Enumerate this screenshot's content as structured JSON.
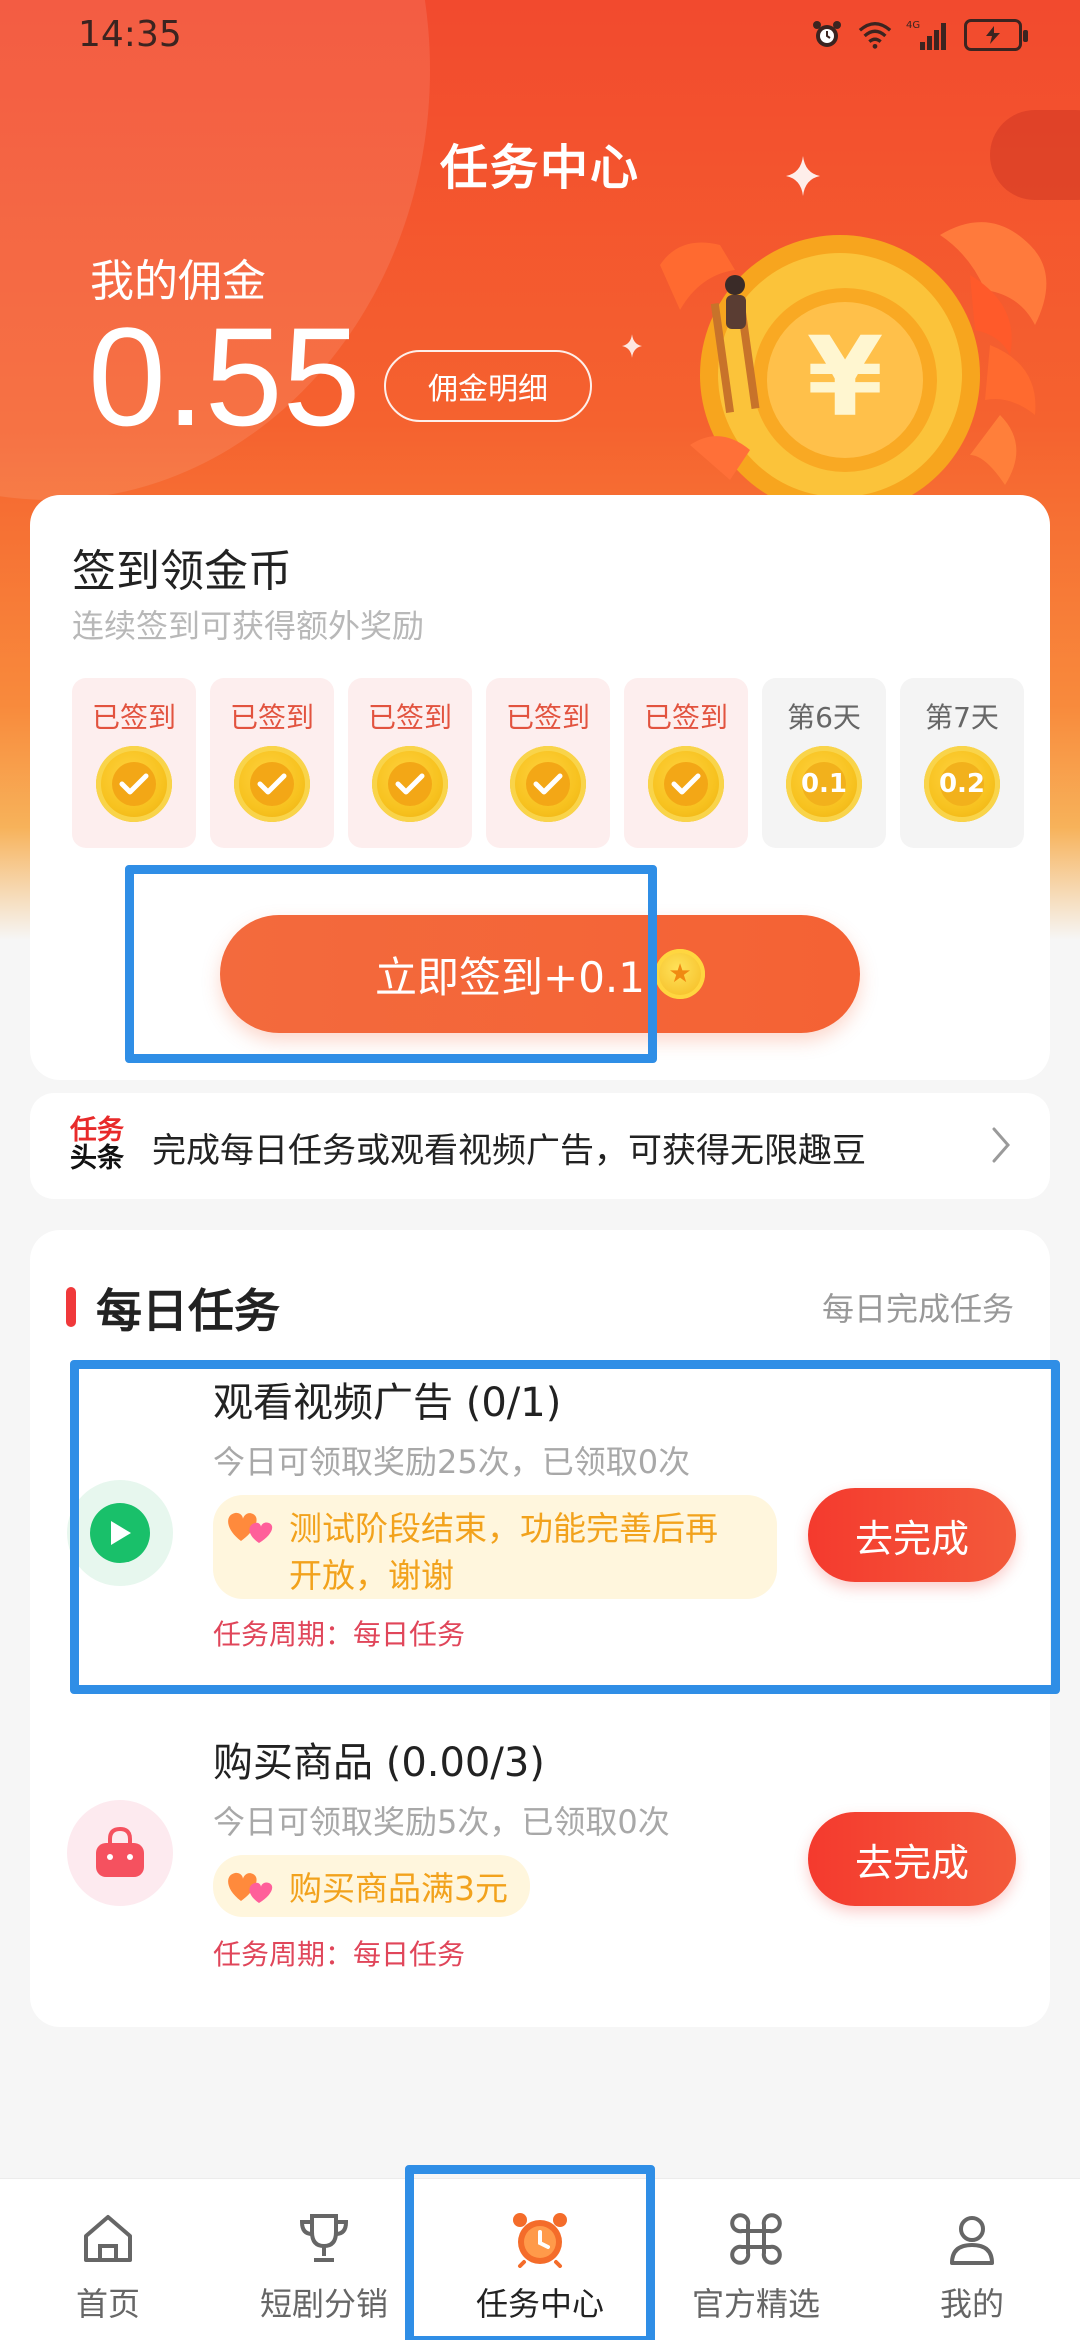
{
  "status_bar": {
    "time": "14:35",
    "network": "4G",
    "battery_icon": "battery-charging-icon"
  },
  "header": {
    "title": "任务中心",
    "commission_label": "我的佣金",
    "commission_value": "0.55",
    "commission_detail_button": "佣金明细"
  },
  "signin": {
    "title": "签到领金币",
    "subtitle": "连续签到可获得额外奖励",
    "days": [
      {
        "label": "已签到",
        "state": "signed"
      },
      {
        "label": "已签到",
        "state": "signed"
      },
      {
        "label": "已签到",
        "state": "signed"
      },
      {
        "label": "已签到",
        "state": "signed"
      },
      {
        "label": "已签到",
        "state": "signed"
      },
      {
        "label": "第6天",
        "state": "future",
        "reward": "0.1"
      },
      {
        "label": "第7天",
        "state": "future",
        "reward": "0.2"
      }
    ],
    "button_label": "立即签到+0.1"
  },
  "news": {
    "logo_line1": "任务",
    "logo_line2": "头条",
    "text": "完成每日任务或观看视频广告，可获得无限趣豆"
  },
  "daily_tasks": {
    "title": "每日任务",
    "right_text": "每日完成任务",
    "items": [
      {
        "name": "观看视频广告 (0/1)",
        "desc": "今日可领取奖励25次，已领取0次",
        "notice": "测试阶段结束，功能完善后再开放，谢谢",
        "period": "任务周期：每日任务",
        "button": "去完成",
        "icon": "play-icon"
      },
      {
        "name": "购买商品 (0.00/3)",
        "desc": "今日可领取奖励5次，已领取0次",
        "notice": "购买商品满3元",
        "period": "任务周期：每日任务",
        "button": "去完成",
        "icon": "shopping-bag-icon"
      }
    ]
  },
  "bottom_nav": {
    "items": [
      {
        "label": "首页",
        "icon": "home-icon"
      },
      {
        "label": "短剧分销",
        "icon": "trophy-icon"
      },
      {
        "label": "任务中心",
        "icon": "alarm-clock-icon",
        "active": true
      },
      {
        "label": "官方精选",
        "icon": "command-icon"
      },
      {
        "label": "我的",
        "icon": "user-icon"
      }
    ]
  },
  "colors": {
    "primary": "#f24a2e",
    "accent_orange": "#f46234",
    "highlight_frame": "#2f8ee6",
    "coin_gold": "#f7c21f"
  }
}
